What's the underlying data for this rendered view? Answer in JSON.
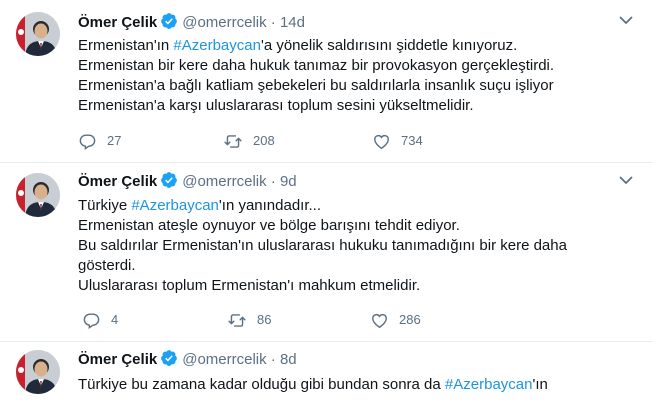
{
  "tweets": [
    {
      "name": "Ömer Çelik",
      "handle": "@omerrcelik",
      "dot": "·",
      "time": "14d",
      "lines": [
        [
          "Ermenistan'ın ",
          "#Azerbaycan",
          "'a yönelik saldırısını şiddetle kınıyoruz."
        ],
        [
          "Ermenistan bir kere daha hukuk tanımaz bir provokasyon gerçekleştirdi."
        ],
        [
          "Ermenistan'a bağlı katliam şebekeleri bu saldırılarla insanlık suçu işliyor"
        ],
        [
          "Ermenistan'a karşı uluslararası toplum sesini yükseltmelidir."
        ]
      ],
      "replies": "27",
      "retweets": "208",
      "likes": "734"
    },
    {
      "name": "Ömer Çelik",
      "handle": "@omerrcelik",
      "dot": "·",
      "time": "9d",
      "lines": [
        [
          "Türkiye ",
          "#Azerbaycan",
          "'ın yanındadır..."
        ],
        [
          "Ermenistan ateşle oynuyor ve bölge barışını tehdit ediyor."
        ],
        [
          "Bu saldırılar Ermenistan'ın uluslararası hukuku tanımadığını bir kere daha"
        ],
        [
          "gösterdi."
        ],
        [
          "Uluslararası toplum Ermenistan'ı mahkum etmelidir."
        ]
      ],
      "replies": "4",
      "retweets": "86",
      "likes": "286"
    },
    {
      "name": "Ömer Çelik",
      "handle": "@omerrcelik",
      "dot": "·",
      "time": "8d",
      "lines": [
        [
          "Türkiye bu zamana kadar olduğu gibi bundan sonra da ",
          "#Azerbaycan",
          "'ın"
        ]
      ]
    }
  ],
  "colors": {
    "verified": "#1da1f2",
    "hashtag": "#1b95e0",
    "muted": "#5b7083",
    "divider": "#e6ecf0"
  },
  "icons": [
    "verified-badge-icon",
    "chevron-down-icon",
    "reply-icon",
    "retweet-icon",
    "like-icon"
  ]
}
